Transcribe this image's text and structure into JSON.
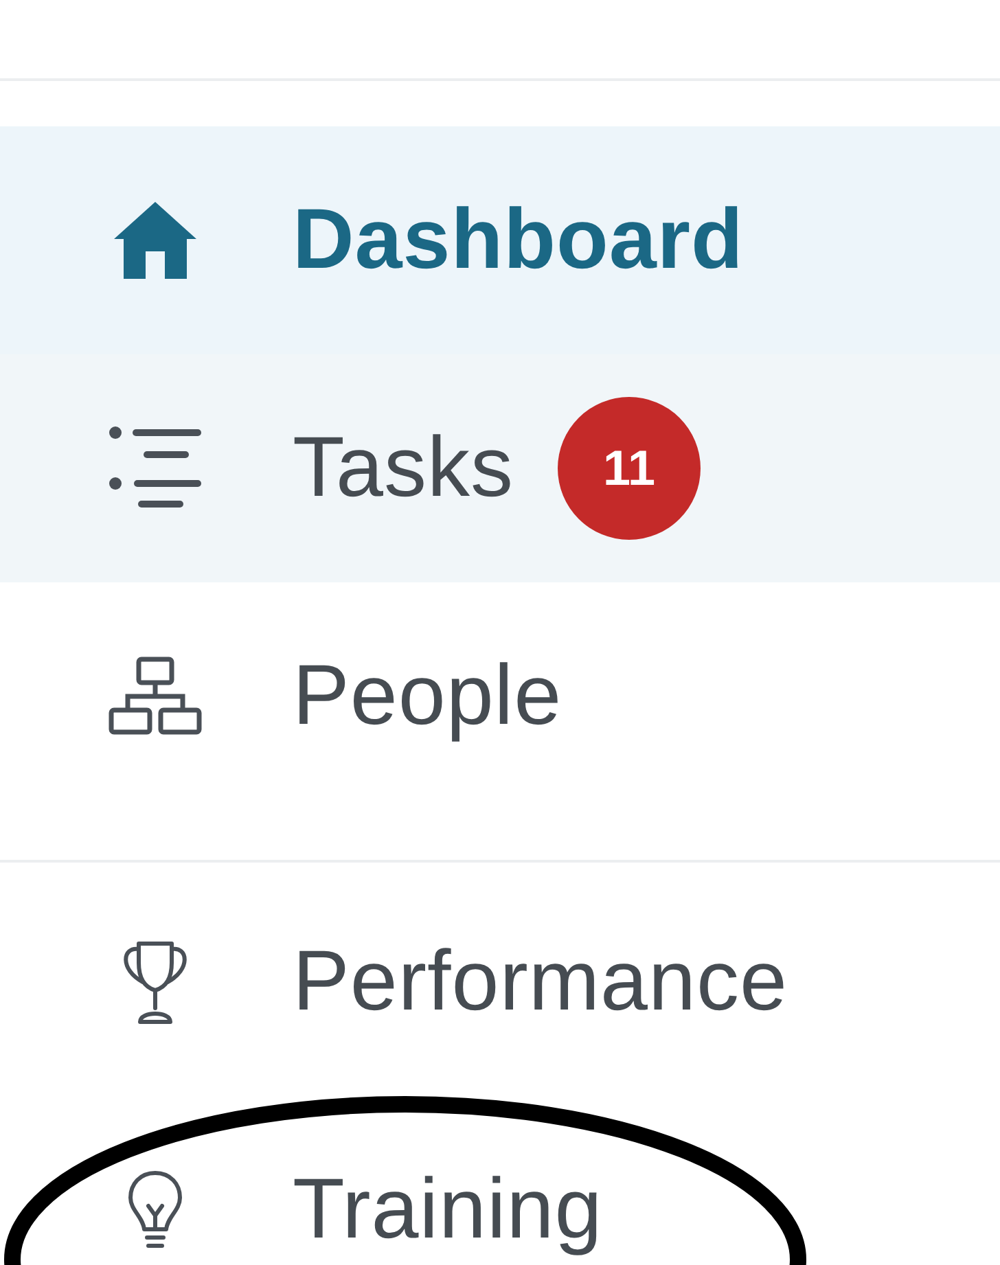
{
  "sidebar": {
    "sections": [
      {
        "items": [
          {
            "label": "Dashboard",
            "selected": true,
            "hovered": false,
            "circled": false
          },
          {
            "label": "Tasks",
            "badge": "11",
            "selected": false,
            "hovered": true,
            "circled": false
          },
          {
            "label": "People",
            "selected": false,
            "hovered": false,
            "circled": false
          }
        ]
      },
      {
        "items": [
          {
            "label": "Performance",
            "selected": false,
            "hovered": false,
            "circled": false
          },
          {
            "label": "Training",
            "selected": false,
            "hovered": false,
            "circled": true
          }
        ]
      }
    ]
  }
}
